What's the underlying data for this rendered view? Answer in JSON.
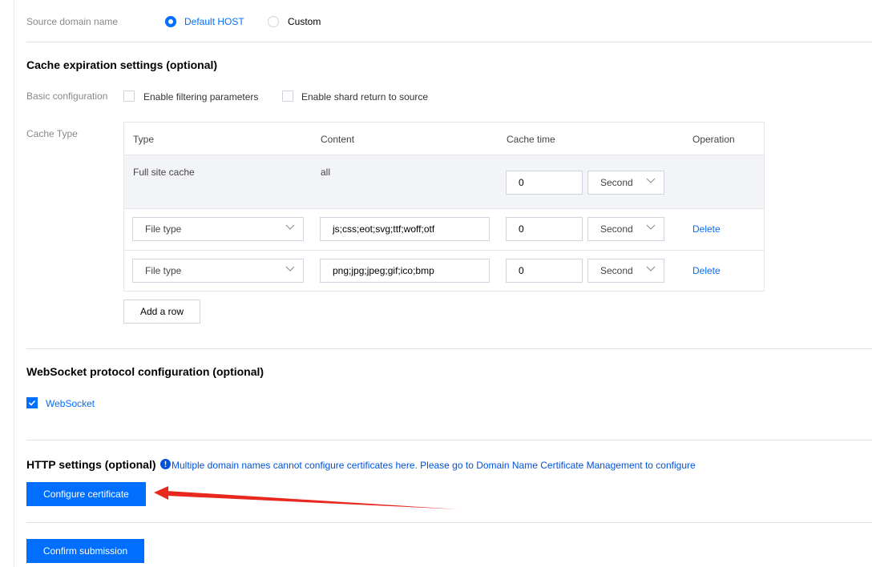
{
  "source_domain": {
    "label": "Source domain name",
    "options": [
      {
        "label": "Default HOST",
        "selected": true
      },
      {
        "label": "Custom",
        "selected": false
      }
    ]
  },
  "cache": {
    "title": "Cache expiration settings (optional)",
    "basic_label": "Basic configuration",
    "checkboxes": [
      {
        "label": "Enable filtering parameters",
        "checked": false
      },
      {
        "label": "Enable shard return to source",
        "checked": false
      }
    ],
    "cache_type_label": "Cache Type",
    "headers": [
      "Type",
      "Content",
      "Cache time",
      "Operation"
    ],
    "full_site": {
      "type": "Full site cache",
      "content": "all",
      "time": "0",
      "unit": "Second"
    },
    "rows": [
      {
        "type": "File type",
        "content": "js;css;eot;svg;ttf;woff;otf",
        "time": "0",
        "unit": "Second",
        "op": "Delete"
      },
      {
        "type": "File type",
        "content": "png;jpg;jpeg;gif;ico;bmp",
        "time": "0",
        "unit": "Second",
        "op": "Delete"
      }
    ],
    "add_row": "Add a row"
  },
  "websocket": {
    "title": "WebSocket protocol configuration (optional)",
    "checkbox_label": "WebSocket",
    "checked": true
  },
  "http": {
    "title": "HTTP settings (optional)",
    "notice": "Multiple domain names cannot configure certificates here. Please go to Domain Name Certificate Management to configure",
    "configure_btn": "Configure certificate"
  },
  "submit_btn": "Confirm submission",
  "colors": {
    "primary": "#006eff",
    "annotation_arrow": "#e8281e"
  }
}
